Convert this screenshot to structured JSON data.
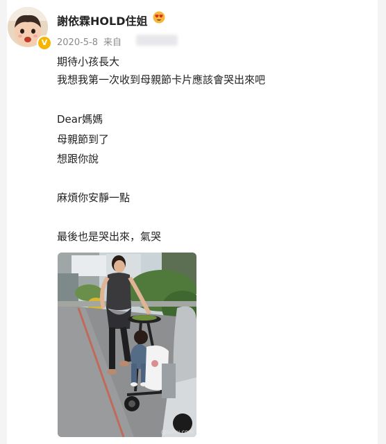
{
  "post": {
    "username": "謝依霖HOLD住姐",
    "date": "2020-5-8",
    "source_label": "来自",
    "lines": [
      "期待小孩長大",
      "我想我第一次收到母親節卡片應該會哭出來吧",
      "Dear媽媽",
      "母親節到了",
      "想跟你說",
      "麻煩你安靜一點",
      "最後也是哭出來，氣哭"
    ],
    "verified_badge": "V",
    "emoji_icon": "heart-eyes-emoji-icon",
    "watermark": "@sohu.com"
  }
}
